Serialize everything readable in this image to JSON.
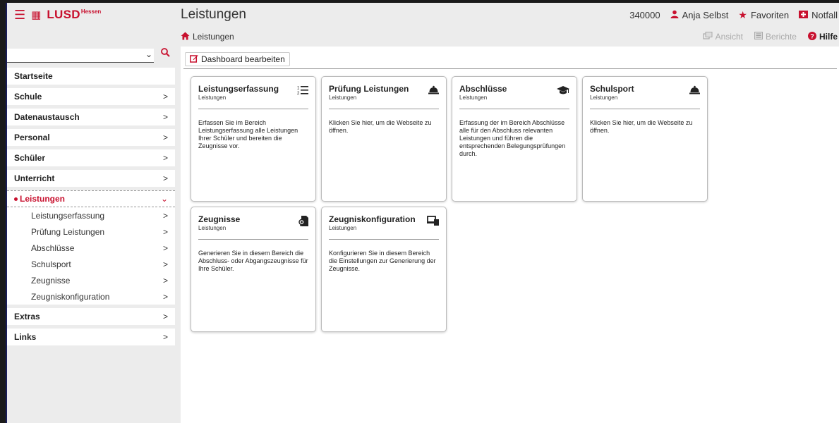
{
  "brand": {
    "name": "LUSD",
    "sup": "Hessen"
  },
  "title": "Leistungen",
  "top_right": {
    "school_number": "340000",
    "user": "Anja Selbst",
    "favorites": "Favoriten",
    "emergency": "Notfall"
  },
  "breadcrumb": {
    "label": "Leistungen"
  },
  "crumb_actions": {
    "view": "Ansicht",
    "reports": "Berichte",
    "help": "Hilfe"
  },
  "search": {
    "value": "",
    "placeholder": ""
  },
  "nav": {
    "items": [
      {
        "label": "Startseite"
      },
      {
        "label": "Schule"
      },
      {
        "label": "Datenaustausch"
      },
      {
        "label": "Personal"
      },
      {
        "label": "Schüler"
      },
      {
        "label": "Unterricht"
      },
      {
        "label": "Leistungen"
      },
      {
        "label": "Extras"
      },
      {
        "label": "Links"
      }
    ],
    "sub_items": [
      {
        "label": "Leistungserfassung"
      },
      {
        "label": "Prüfung Leistungen"
      },
      {
        "label": "Abschlüsse"
      },
      {
        "label": "Schulsport"
      },
      {
        "label": "Zeugnisse"
      },
      {
        "label": "Zeugniskonfiguration"
      }
    ]
  },
  "dashboard_edit": "Dashboard bearbeiten",
  "tiles": [
    {
      "title": "Leistungserfassung",
      "subtitle": "Leistungen",
      "icon": "numbered-list-icon",
      "description": "Erfassen Sie im Bereich Leistungserfassung alle Leistungen Ihrer Schüler und bereiten die Zeugnisse vor."
    },
    {
      "title": "Prüfung Leistungen",
      "subtitle": "Leistungen",
      "icon": "bell-icon",
      "description": "Klicken Sie hier, um die Webseite zu öffnen."
    },
    {
      "title": "Abschlüsse",
      "subtitle": "Leistungen",
      "icon": "graduation-cap-icon",
      "description": "Erfassung der im Bereich Abschlüsse alle für den Abschluss relevanten Leistungen und führen die entsprechenden Belegungsprüfungen durch."
    },
    {
      "title": "Schulsport",
      "subtitle": "Leistungen",
      "icon": "bell-icon",
      "description": "Klicken Sie hier, um die Webseite zu öffnen."
    },
    {
      "title": "Zeugnisse",
      "subtitle": "Leistungen",
      "icon": "certificate-file-icon",
      "description": "Generieren Sie in diesem Bereich die Abschluss- oder Abgangszeugnisse für Ihre Schüler."
    },
    {
      "title": "Zeugniskonfiguration",
      "subtitle": "Leistungen",
      "icon": "devices-icon",
      "description": "Konfigurieren Sie in diesem Bereich die Einstellungen zur Generierung der Zeugnisse."
    }
  ],
  "colors": {
    "accent": "#c8102e",
    "frame": "#1a1d5a"
  }
}
